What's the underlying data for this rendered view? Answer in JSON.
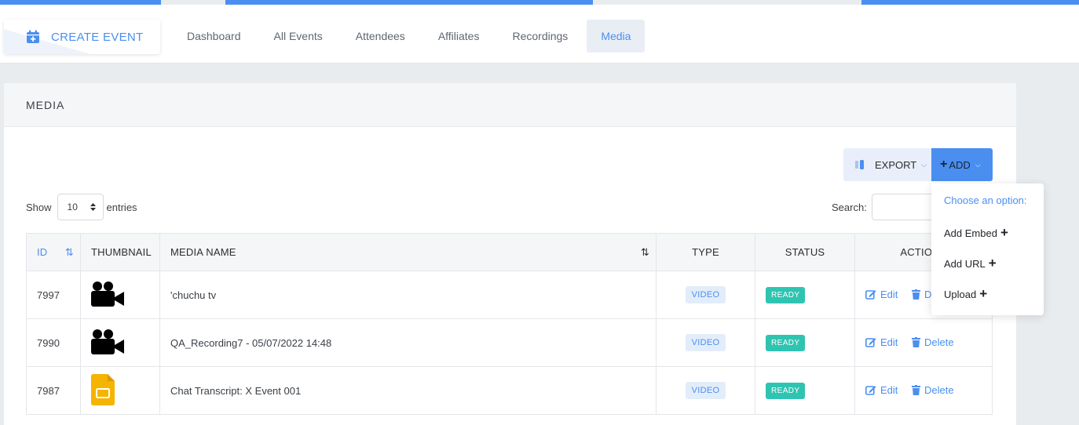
{
  "nav": {
    "create_label": "CREATE EVENT",
    "links": [
      "Dashboard",
      "All Events",
      "Attendees",
      "Affiliates",
      "Recordings",
      "Media"
    ],
    "active": "Media"
  },
  "card": {
    "title": "MEDIA"
  },
  "toolbar": {
    "export_label": "EXPORT",
    "add_label": "ADD"
  },
  "table_controls": {
    "show_label": "Show",
    "page_length": "10",
    "entries_label": "entries",
    "search_label": "Search:"
  },
  "table": {
    "headers": [
      "ID",
      "THUMBNAIL",
      "MEDIA NAME",
      "TYPE",
      "STATUS",
      "ACTIONS"
    ],
    "rows": [
      {
        "id": "7997",
        "thumbnail": "video-camera-icon",
        "name": "'chuchu tv",
        "type": "VIDEO",
        "status": "READY",
        "edit": "Edit",
        "delete": "Delete"
      },
      {
        "id": "7990",
        "thumbnail": "video-camera-icon",
        "name": "QA_Recording7 - 05/07/2022 14:48",
        "type": "VIDEO",
        "status": "READY",
        "edit": "Edit",
        "delete": "Delete"
      },
      {
        "id": "7987",
        "thumbnail": "slides-file-icon",
        "name": "Chat Transcript: X Event 001",
        "type": "VIDEO",
        "status": "READY",
        "edit": "Edit",
        "delete": "Delete"
      }
    ]
  },
  "add_menu": {
    "heading": "Choose an option:",
    "items": [
      "Add Embed",
      "Add URL",
      "Upload"
    ]
  },
  "colors": {
    "accent": "#4a8ff0",
    "ready": "#2fc4b2",
    "type_badge_bg": "#e3edfa"
  }
}
